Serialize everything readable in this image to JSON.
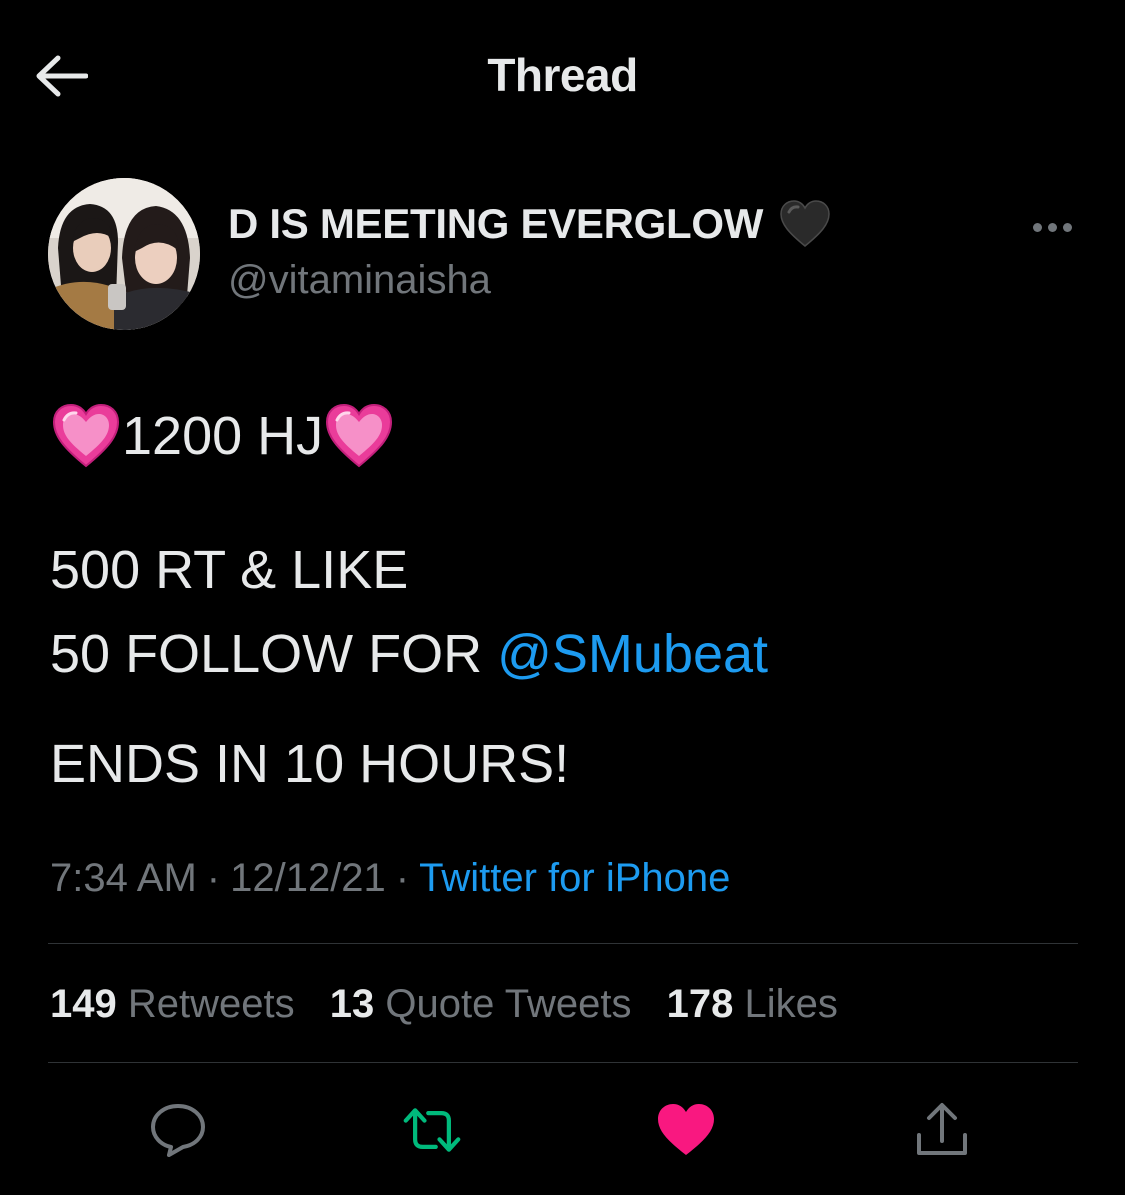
{
  "header": {
    "title": "Thread"
  },
  "author": {
    "name": "D IS MEETING EVERGLOW",
    "handle": "@vitaminaisha"
  },
  "tweet": {
    "line1_text": "1200 HJ",
    "line2": "500 RT & LIKE",
    "line3_prefix": "50 FOLLOW FOR ",
    "line3_mention": "@SMubeat",
    "line4": "ENDS IN 10 HOURS!"
  },
  "meta": {
    "time": "7:34 AM",
    "date": "12/12/21",
    "separator": "·",
    "source": "Twitter for iPhone"
  },
  "stats": {
    "retweets_count": "149",
    "retweets_label": "Retweets",
    "quotes_count": "13",
    "quotes_label": "Quote Tweets",
    "likes_count": "178",
    "likes_label": "Likes"
  },
  "icons": {
    "back": "back-arrow-icon",
    "more": "more-icon",
    "reply": "reply-icon",
    "retweet": "retweet-icon",
    "like": "like-icon",
    "share": "share-icon",
    "emoji_pink_heart": "pink-heart-emoji",
    "emoji_black_heart": "black-heart-emoji"
  },
  "colors": {
    "background": "#000000",
    "text": "#e7e9ea",
    "secondary": "#71767b",
    "accent": "#1d9bf0",
    "retweet_active": "#00ba7c",
    "like_active": "#f91880",
    "divider": "#2f3336"
  }
}
